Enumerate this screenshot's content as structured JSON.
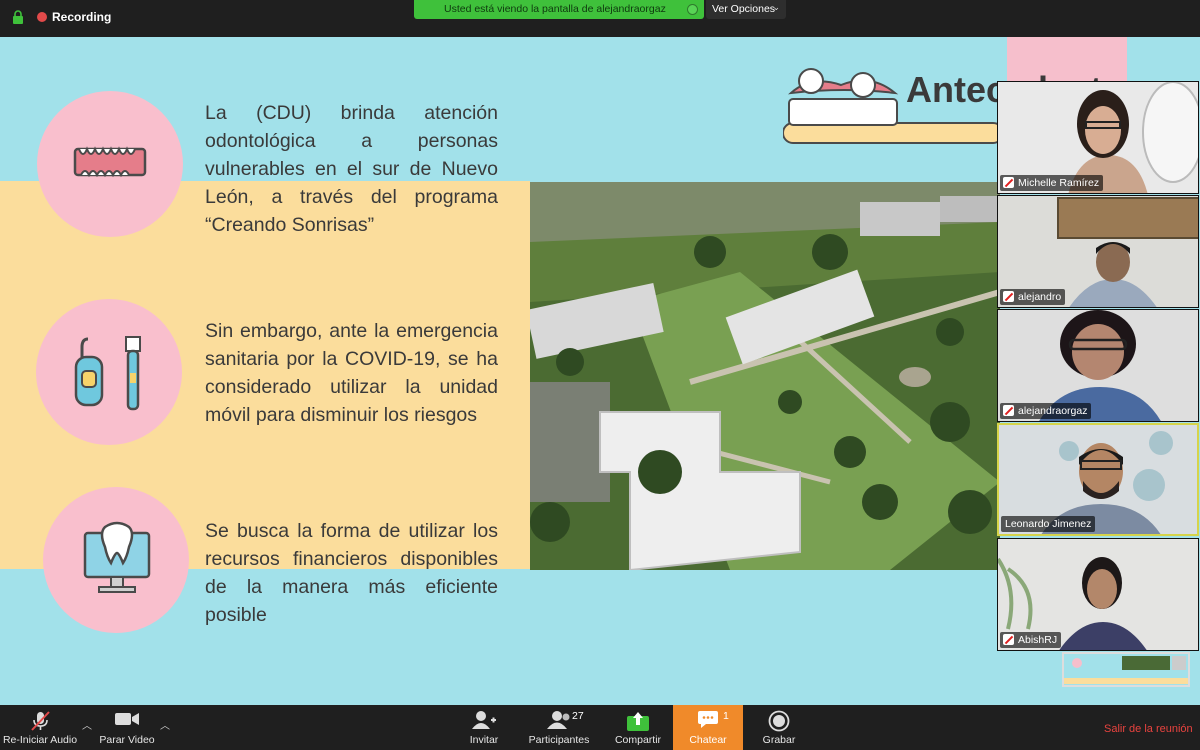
{
  "top_bar": {
    "recording_label": "Recording",
    "share_notice": "Usted está viendo la pantalla de alejandraorgaz",
    "view_options_label": "Ver Opciones"
  },
  "slide": {
    "title": "Antecedentes",
    "paragraphs": [
      "La (CDU) brinda atención odontológica a personas vulnerables en el sur de Nuevo León, a través del programa “Creando Sonrisas”",
      "Sin embargo, ante la emergencia sanitaria por la COVID-19, se ha considerado utilizar la unidad móvil para disminuir los riesgos",
      "Se busca la forma de utilizar los recursos financieros disponibles de la manera más eficiente posible"
    ],
    "colors": {
      "background": "#a2e1ea",
      "band": "#fbdd9c",
      "circle": "#f9bfcd"
    },
    "icons": [
      "teeth-icon",
      "dental-tools-icon",
      "tooth-monitor-icon"
    ]
  },
  "participants": [
    {
      "name": "Michelle Ramírez",
      "muted": true
    },
    {
      "name": "alejandro",
      "muted": true
    },
    {
      "name": "alejandraorgaz",
      "muted": true
    },
    {
      "name": "Leonardo Jimenez",
      "muted": false,
      "active_speaker": true
    },
    {
      "name": "AbishRJ",
      "muted": true
    }
  ],
  "toolbar": {
    "audio_label": "Re-Iniciar Audio",
    "video_label": "Parar Video",
    "invite_label": "Invitar",
    "participants_label": "Participantes",
    "participants_count": "27",
    "share_label": "Compartir",
    "chat_label": "Chatear",
    "chat_count": "1",
    "record_label": "Grabar",
    "leave_label": "Salir de la reunión",
    "colors": {
      "chat_active": "#f08a2a",
      "leave": "#e8433f",
      "share": "#3fc13b"
    }
  }
}
